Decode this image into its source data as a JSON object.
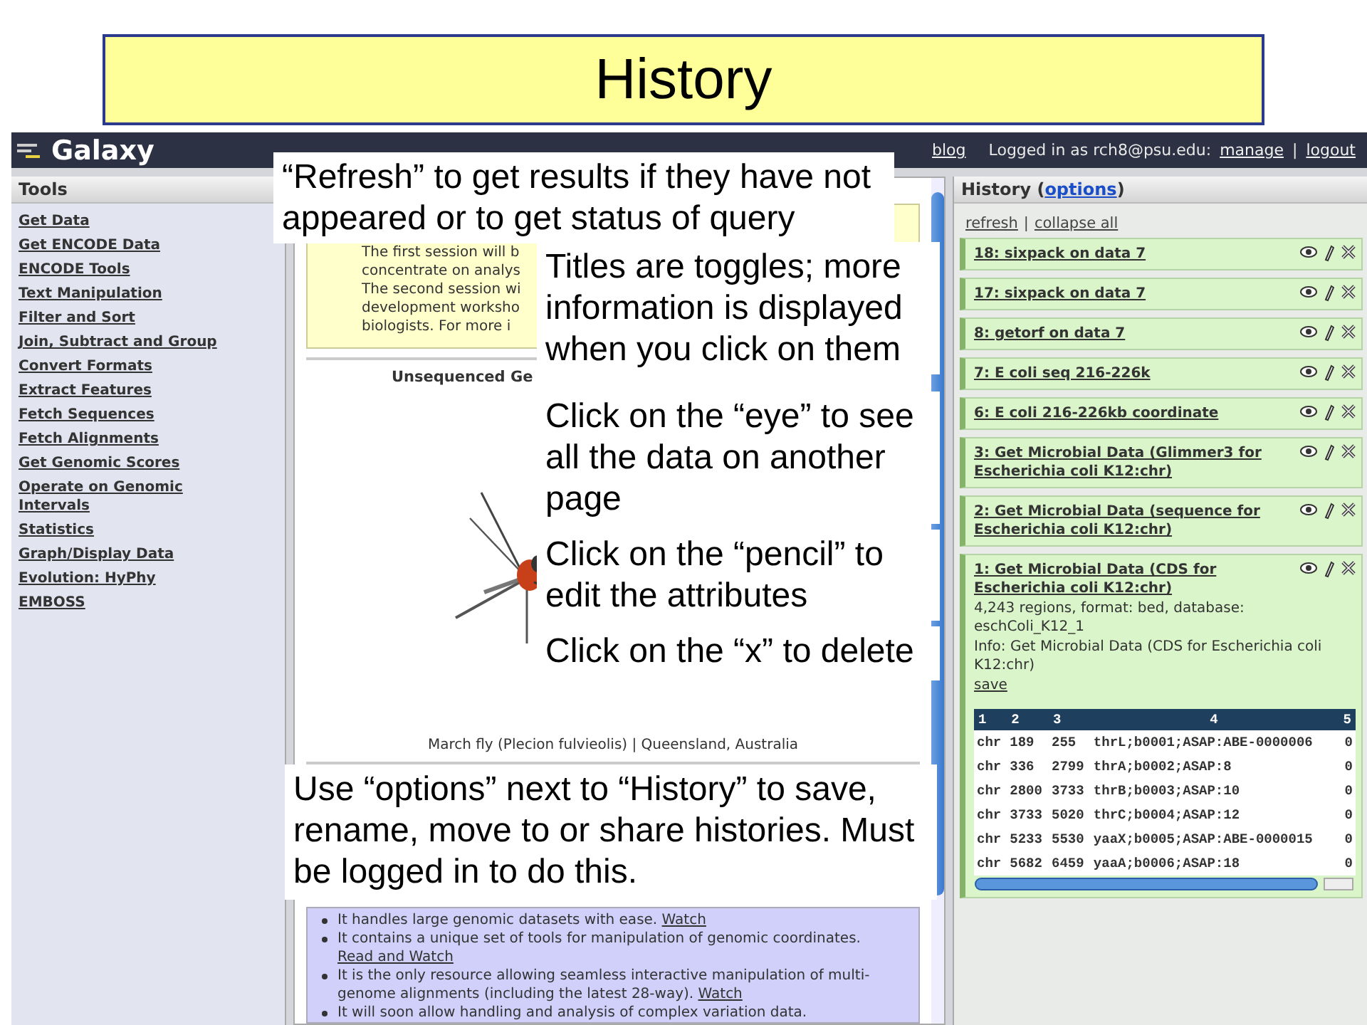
{
  "slide_title": "History",
  "galaxy": {
    "logo": "Galaxy",
    "header": {
      "blog": "blog",
      "user": "Logged in as rch8@psu.edu:",
      "links": [
        "manage",
        "logout"
      ],
      "separator": "|"
    },
    "tools": {
      "title": "Tools",
      "items": [
        "Get Data",
        "Get ENCODE Data",
        "ENCODE Tools",
        "Text Manipulation",
        "Filter and Sort",
        "Join, Subtract and Group",
        "Convert Formats",
        "Extract Features",
        "Fetch Sequences",
        "Fetch Alignments",
        "Get Genomic Scores",
        "Operate on Genomic Intervals",
        "Statistics",
        "Graph/Display Data",
        "Evolution: HyPhy",
        "EMBOSS"
      ]
    },
    "center": {
      "notice_lines": [
        "The first session will b",
        "concentrate on analys",
        "The second session wi",
        "development worksho",
        "biologists. For more i"
      ],
      "section_title": "Unsequenced Ge",
      "picture": {
        "kind": "picture"
      },
      "caption": "March fly (Plecion fulvieolis) | Queensland, Australia",
      "bullets": [
        {
          "text": "It handles large genomic datasets with ease.",
          "link": "Watch"
        },
        {
          "text": "It contains a unique set of tools for manipulation of genomic coordinates.",
          "link": "Read and Watch"
        },
        {
          "text": "It is the only resource allowing seamless interactive manipulation of multi-genome alignments (including the latest 28-way).",
          "link": "Watch"
        },
        {
          "text": "It will soon allow handling and analysis of complex variation data."
        }
      ]
    },
    "history": {
      "title": "History (",
      "link": "options",
      "title_close": ")",
      "actions": [
        "refresh",
        "collapse all"
      ],
      "separator": "|",
      "items": [
        {
          "title": "18: sixpack on data 7"
        },
        {
          "title": "17: sixpack on data 7"
        },
        {
          "title": "8: getorf on data 7"
        },
        {
          "title": "7: E coli seq 216-226k"
        },
        {
          "title": "6: E coli 216-226kb coordinate"
        },
        {
          "title": "3: Get Microbial Data (Glimmer3 for Escherichia coli K12:chr)"
        },
        {
          "title": "2: Get Microbial Data (sequence for Escherichia coli K12:chr)"
        },
        {
          "title": "1: Get Microbial Data (CDS for Escherichia coli K12:chr)",
          "details": [
            "4,243 regions, format: bed, database: eschColi_K12_1",
            "Info: Get Microbial Data (CDS for Escherichia coli K12:chr)"
          ],
          "save": "save",
          "table": {
            "columns": [
              "1",
              "2",
              "3",
              "4",
              "5"
            ],
            "rows": [
              [
                "chr",
                "189",
                "255",
                "thrL;b0001;ASAP:ABE-0000006",
                "0"
              ],
              [
                "chr",
                "336",
                "2799",
                "thrA;b0002;ASAP:8",
                "0"
              ],
              [
                "chr",
                "2800",
                "3733",
                "thrB;b0003;ASAP:10",
                "0"
              ],
              [
                "chr",
                "3733",
                "5020",
                "thrC;b0004;ASAP:12",
                "0"
              ],
              [
                "chr",
                "5233",
                "5530",
                "yaaX;b0005;ASAP:ABE-0000015",
                "0"
              ],
              [
                "chr",
                "5682",
                "6459",
                "yaaA;b0006;ASAP:18",
                "0"
              ]
            ]
          }
        }
      ]
    }
  },
  "callouts": [
    "“Refresh” to get results if they have not appeared or to get status of query",
    "Titles are toggles; more information is displayed when you click on them",
    "Click on the “eye” to see all the data on another page",
    "Click on the “pencil” to edit the attributes",
    "Click on the “x” to delete",
    "Use “options” next to “History” to save, rename, move to or share histories. Must be logged in to do this."
  ]
}
